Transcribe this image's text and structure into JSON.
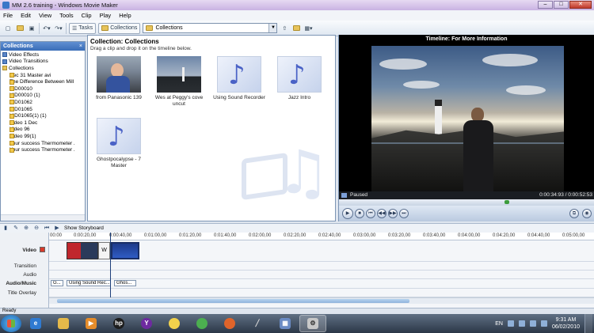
{
  "window": {
    "title": "MM 2.6 training - Windows Movie Maker"
  },
  "menu": [
    "File",
    "Edit",
    "View",
    "Tools",
    "Clip",
    "Play",
    "Help"
  ],
  "toolbar": {
    "tasks_label": "Tasks",
    "collections_label": "Collections",
    "location_value": "Collections"
  },
  "collections_pane": {
    "title": "Collections",
    "items": [
      {
        "label": "Video Effects",
        "level": 0
      },
      {
        "label": "Video Transitions",
        "level": 0
      },
      {
        "label": "Collections",
        "level": 0
      },
      {
        "label": "Dec 31 Master avi",
        "level": 1
      },
      {
        "label": "The Difference Between Mill",
        "level": 1
      },
      {
        "label": "VID00010",
        "level": 1
      },
      {
        "label": "VID00010 (1)",
        "level": 1
      },
      {
        "label": "VID01062",
        "level": 1
      },
      {
        "label": "VID01065",
        "level": 1
      },
      {
        "label": "VID01065(1) (1)",
        "level": 1
      },
      {
        "label": "Video 1 Dec",
        "level": 1
      },
      {
        "label": "Video 96",
        "level": 1
      },
      {
        "label": "Video 99(1)",
        "level": 1
      },
      {
        "label": "Your success Thermometer .",
        "level": 1
      },
      {
        "label": "Your success Thermometer .",
        "level": 1
      }
    ]
  },
  "contents": {
    "heading": "Collection: Collections",
    "subtitle": "Drag a clip and drop it on the timeline below.",
    "clips": [
      {
        "caption": "from Panasonic 139",
        "kind": "photo-man"
      },
      {
        "caption": "Wes at Peggy's cove uncut",
        "kind": "photo-lighthouse"
      },
      {
        "caption": "Using Sound Recorder",
        "kind": "music"
      },
      {
        "caption": "Jazz Intro",
        "kind": "music"
      },
      {
        "caption": "Ghostpocalypse - 7 Master",
        "kind": "music"
      }
    ]
  },
  "preview": {
    "title": "Timeline: For More Information",
    "status": "Paused",
    "time": "0:00:34:93 / 0:00:52:53",
    "seek_fraction": 0.66
  },
  "timeline_toolbar": {
    "storyboard_label": "Show Storyboard"
  },
  "timeline": {
    "ruler_ticks": [
      "00:00",
      "0:00:20,00",
      "0:00:40,00",
      "0:01:00,00",
      "0:01:20,00",
      "0:01:40,00",
      "0:02:00,00",
      "0:02:20,00",
      "0:02:40,00",
      "0:03:00,00",
      "0:03:20,00",
      "0:03:40,00",
      "0:04:00,00",
      "0:04:20,00",
      "0:04:40,00",
      "0:05:00,00"
    ],
    "tracks": {
      "video": "Video",
      "transition": "Transition",
      "audio": "Audio",
      "audio_music": "Audio/Music",
      "title_overlay": "Title Overlay"
    },
    "audio_music_clips": [
      "G...",
      "Using Sound Rec...",
      "Ghos..."
    ],
    "transition_marker": "W"
  },
  "statusbar": {
    "text": "Ready"
  },
  "taskbar": {
    "language": "EN",
    "time": "9:31 AM",
    "date": "06/02/2010"
  }
}
